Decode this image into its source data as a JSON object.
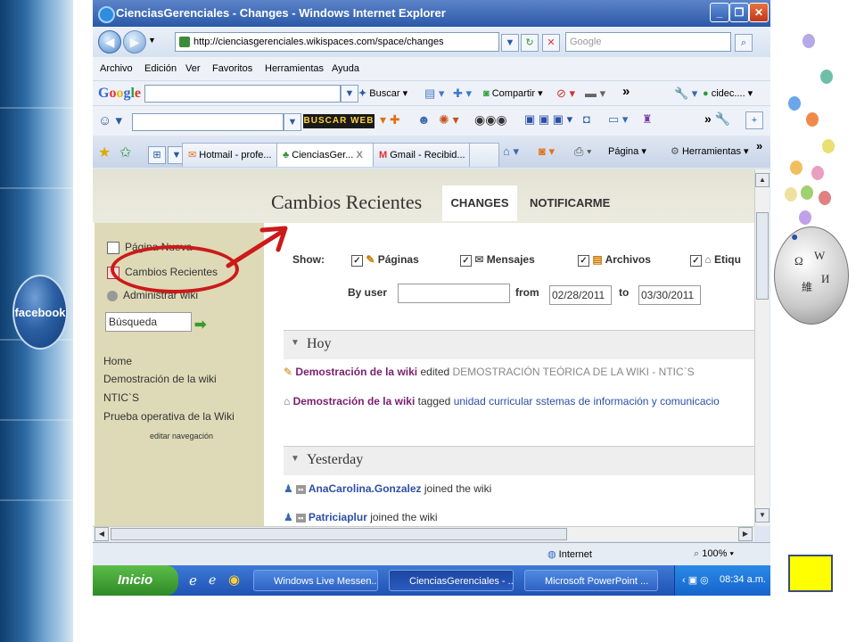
{
  "left_panel": {
    "badge_label": "facebook"
  },
  "window": {
    "title": "CienciasGerenciales - Changes - Windows Internet Explorer",
    "url": "http://cienciasgerenciales.wikispaces.com/space/changes",
    "search_placeholder": "Google"
  },
  "menu": [
    "Archivo",
    "Edición",
    "Ver",
    "Favoritos",
    "Herramientas",
    "Ayuda"
  ],
  "google_toolbar": {
    "buscar_label": "Buscar",
    "compartir_label": "Compartir",
    "chevron": "»",
    "user_label": "cidec...."
  },
  "toolbar3": {
    "buscar_web_label": "BUSCAR WEB"
  },
  "tabs": [
    {
      "label": "Hotmail - profe..."
    },
    {
      "label": "CienciasGer...",
      "close": "X"
    },
    {
      "label": "Gmail - Recibid..."
    }
  ],
  "tab_tools": {
    "page_label": "Página",
    "tools_label": "Herramientas"
  },
  "page": {
    "title": "Cambios Recientes",
    "tab_changes": "CHANGES",
    "tab_notify": "NOTIFICARME"
  },
  "sidebar": {
    "items": [
      "Página Nueva",
      "Cambios Recientes",
      "Administrar wiki"
    ],
    "search_value": "Búsqueda",
    "nav_links": [
      "Home",
      "Demostración de la wiki",
      "NTIC`S",
      "Prueba operativa de la Wiki"
    ],
    "edit_nav": "editar navegación"
  },
  "filters": {
    "show_label": "Show:",
    "options": [
      "Páginas",
      "Mensajes",
      "Archivos",
      "Etiqu"
    ],
    "by_user_label": "By user",
    "from_label": "from",
    "from_date": "02/28/2011",
    "to_label": "to",
    "to_date": "03/30/2011"
  },
  "sections": {
    "today": {
      "heading": "Hoy",
      "rows": [
        {
          "link": "Demostración de la wiki",
          "action": "edited",
          "detail": "DEMOSTRACIÓN TEÓRICA DE LA WIKI - NTIC`S"
        },
        {
          "link": "Demostración de la wiki",
          "action": "tagged",
          "detail": "unidad curricular sstemas de información y comunicacio"
        }
      ]
    },
    "yesterday": {
      "heading": "Yesterday",
      "rows": [
        {
          "user": "AnaCarolina.Gonzalez",
          "action": "joined the wiki"
        },
        {
          "user": "Patriciaplur",
          "action": "joined the wiki"
        }
      ]
    }
  },
  "statusbar": {
    "zone": "Internet",
    "zoom": "100%"
  },
  "taskbar": {
    "start_label": "Inicio",
    "tasks": [
      "Windows Live Messen...",
      "CienciasGerenciales - ...",
      "Microsoft PowerPoint ..."
    ],
    "clock": "08:34 a.m."
  },
  "colors": {
    "annotation_red": "#cc1a1a",
    "sidebar_bg": "#dedab7",
    "yellow_square": "#ffff00"
  }
}
